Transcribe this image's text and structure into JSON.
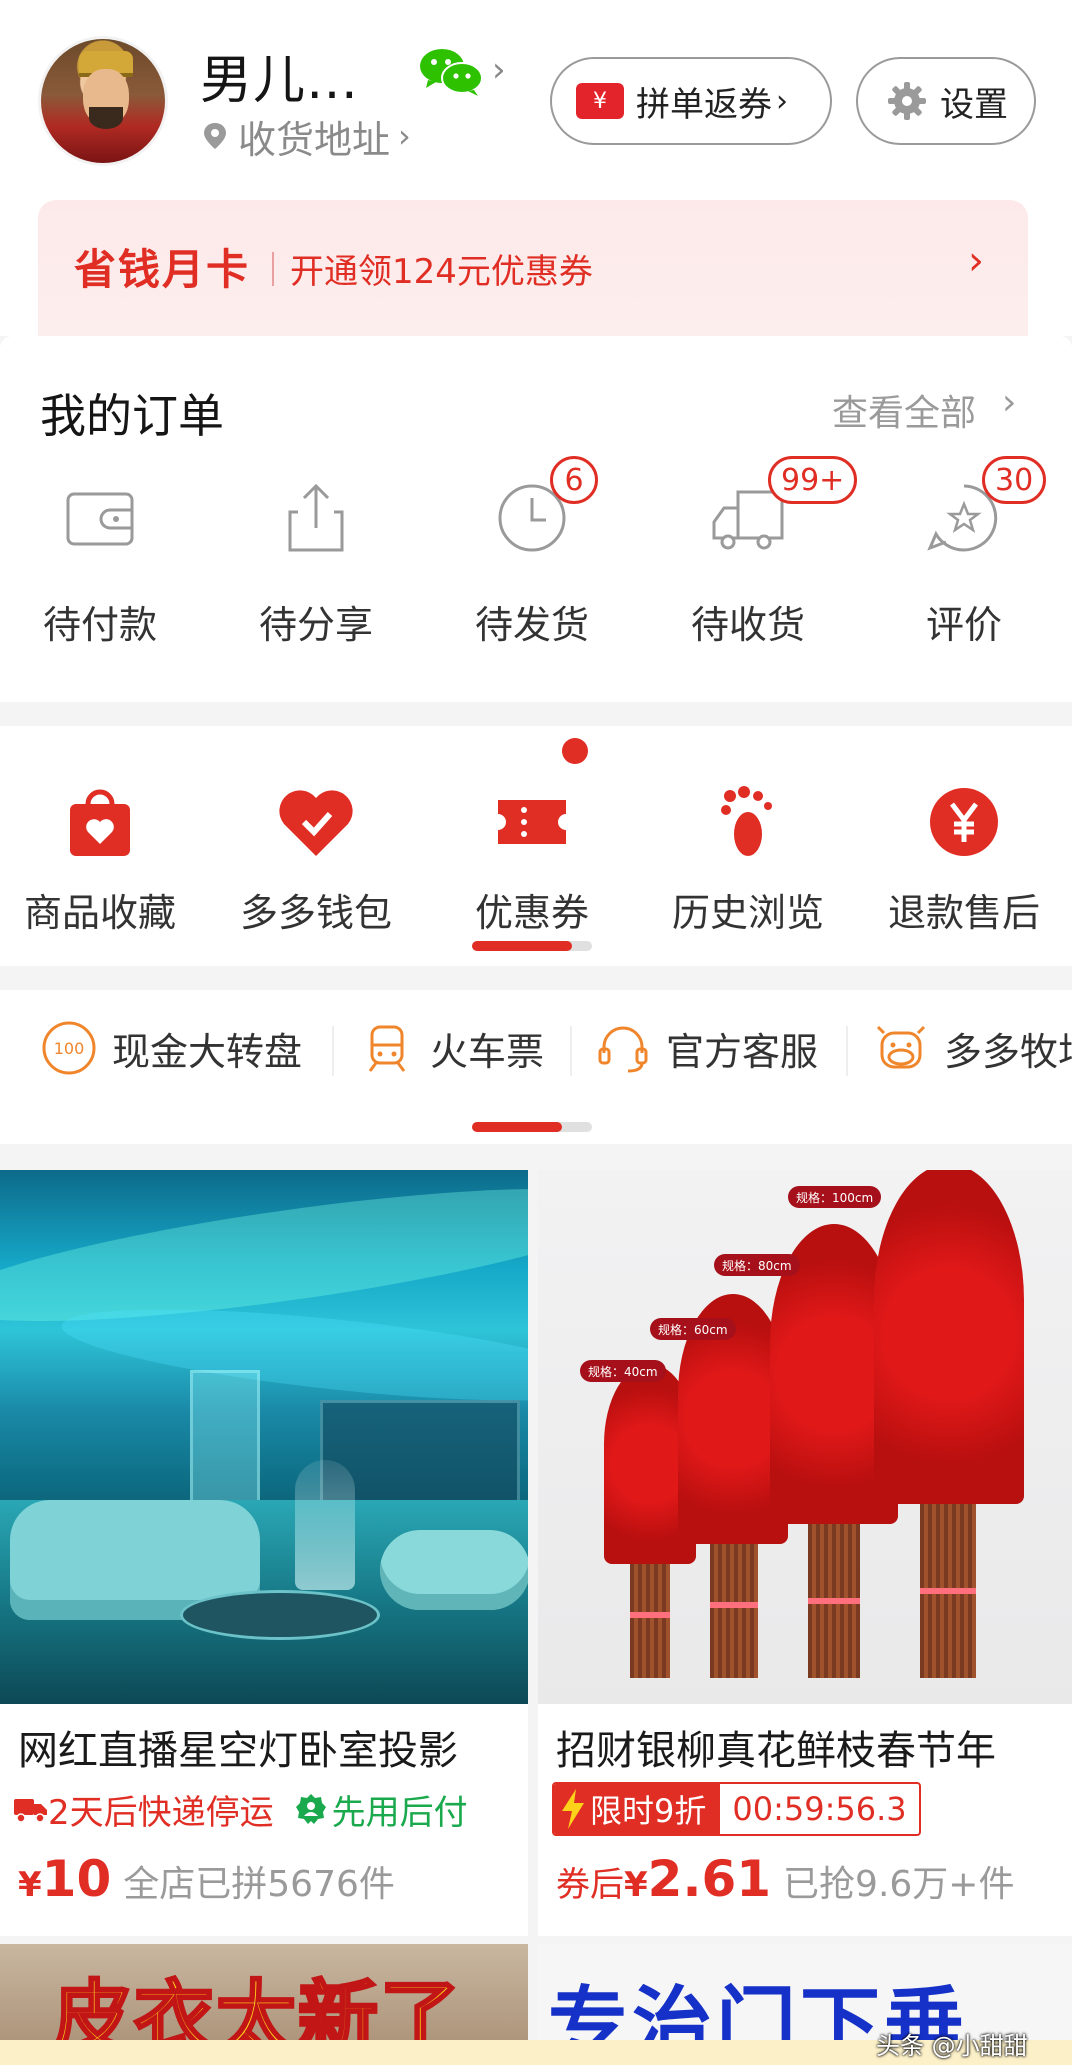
{
  "profile": {
    "username": "男儿…",
    "address_label": "收货地址",
    "coupon_button": "拼单返券",
    "coupon_icon_symbol": "¥",
    "settings_button": "设置"
  },
  "month_card": {
    "title": "省钱月卡",
    "text": "开通领124元优惠券"
  },
  "orders": {
    "title": "我的订单",
    "view_all": "查看全部",
    "items": [
      {
        "label": "待付款",
        "icon": "wallet-icon",
        "badge": ""
      },
      {
        "label": "待分享",
        "icon": "share-icon",
        "badge": ""
      },
      {
        "label": "待发货",
        "icon": "clock-icon",
        "badge": "6"
      },
      {
        "label": "待收货",
        "icon": "truck-icon",
        "badge": "99+"
      },
      {
        "label": "评价",
        "icon": "review-icon",
        "badge": "30"
      }
    ]
  },
  "services": {
    "items": [
      {
        "label": "商品收藏",
        "icon": "bag-heart-icon"
      },
      {
        "label": "多多钱包",
        "icon": "wallet-heart-icon"
      },
      {
        "label": "优惠券",
        "icon": "ticket-icon"
      },
      {
        "label": "历史浏览",
        "icon": "footprint-icon"
      },
      {
        "label": "退款售后",
        "icon": "yuan-circle-icon"
      }
    ],
    "active_dot_on": "优惠券"
  },
  "quick_links": {
    "items": [
      {
        "label": "现金大转盘",
        "icon": "wheel-100-icon"
      },
      {
        "label": "火车票",
        "icon": "train-icon"
      },
      {
        "label": "官方客服",
        "icon": "headset-icon"
      },
      {
        "label": "多多牧场",
        "icon": "cow-icon"
      }
    ]
  },
  "products": [
    {
      "title": "网红直播星空灯卧室投影",
      "shipping_note": "2天后快递停运",
      "pay_later": "先用后付",
      "price_symbol": "¥",
      "price": "10",
      "sold": "全店已拼5676件"
    },
    {
      "title": "招财银柳真花鲜枝春节年",
      "flash_label": "限时9折",
      "countdown": "00:59:56.3",
      "price_prefix": "券后",
      "price_symbol": "¥",
      "price": "2.61",
      "sold": "已抢9.6万+件",
      "size_tags": [
        "规格：100cm",
        "规格：80cm",
        "规格：60cm",
        "规格：40cm"
      ]
    }
  ],
  "bottom_cards": {
    "left_text": "皮衣太新了",
    "right_text": "专治门下垂"
  },
  "watermark": "头条 @小甜甜",
  "colors": {
    "accent": "#e02e24",
    "green": "#1aa94d",
    "muted": "#9a9a9a"
  }
}
